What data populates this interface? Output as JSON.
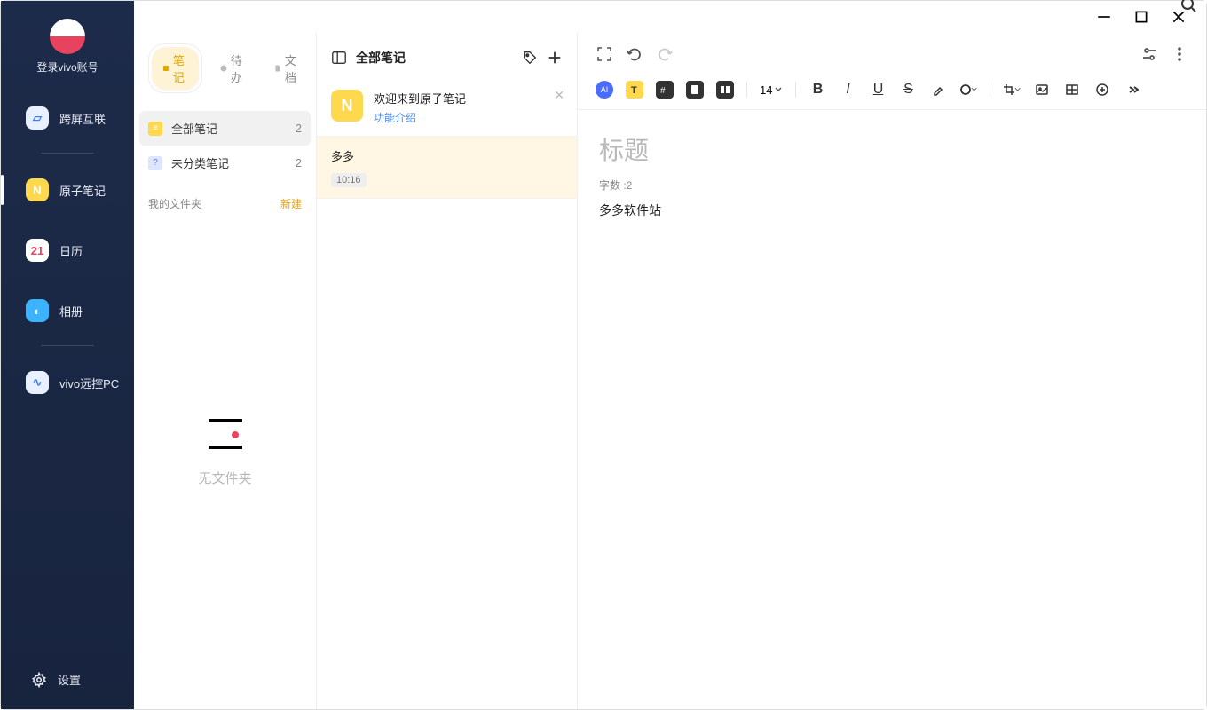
{
  "rail": {
    "login_label": "登录vivo账号",
    "items": [
      {
        "id": "crossscreen",
        "label": "跨屏互联",
        "bg": "#e9f0ff",
        "fg": "#3b7bff",
        "glyph": "▱"
      },
      {
        "id": "notes",
        "label": "原子笔记",
        "bg": "#ffd94d",
        "fg": "#fff",
        "glyph": "N"
      },
      {
        "id": "calendar",
        "label": "日历",
        "bg": "#ffffff",
        "fg": "#e7435f",
        "glyph": "21"
      },
      {
        "id": "album",
        "label": "相册",
        "bg": "#3bb3ff",
        "fg": "#fff",
        "glyph": "◐"
      },
      {
        "id": "remotepc",
        "label": "vivo远控PC",
        "bg": "#e9f0ff",
        "fg": "#3b7bff",
        "glyph": "∿"
      }
    ],
    "active": "notes",
    "settings_label": "设置"
  },
  "tabs": {
    "notes": "笔记",
    "todo": "待办",
    "docs": "文档",
    "active": "notes"
  },
  "folders": {
    "rows": [
      {
        "id": "all",
        "label": "全部笔记",
        "count": 2,
        "icon_bg": "#ffd94d",
        "icon_fg": "#fff",
        "glyph": "≡"
      },
      {
        "id": "uncat",
        "label": "未分类笔记",
        "count": 2,
        "icon_bg": "#dce7ff",
        "icon_fg": "#5a7bff",
        "glyph": "?"
      }
    ],
    "selected": "all",
    "my_folders_label": "我的文件夹",
    "new_label": "新建",
    "empty_label": "无文件夹"
  },
  "notelist": {
    "header_title": "全部笔记",
    "items": [
      {
        "id": "welcome",
        "title": "欢迎来到原子笔记",
        "subtitle": "功能介绍",
        "closable": true
      },
      {
        "id": "duoduo",
        "title": "多多",
        "time": "10:16",
        "selected": true
      }
    ]
  },
  "editor": {
    "toolbar": {
      "font_size": "14"
    },
    "title_placeholder": "标题",
    "word_count_label": "字数 :2",
    "content": "多多软件站"
  }
}
